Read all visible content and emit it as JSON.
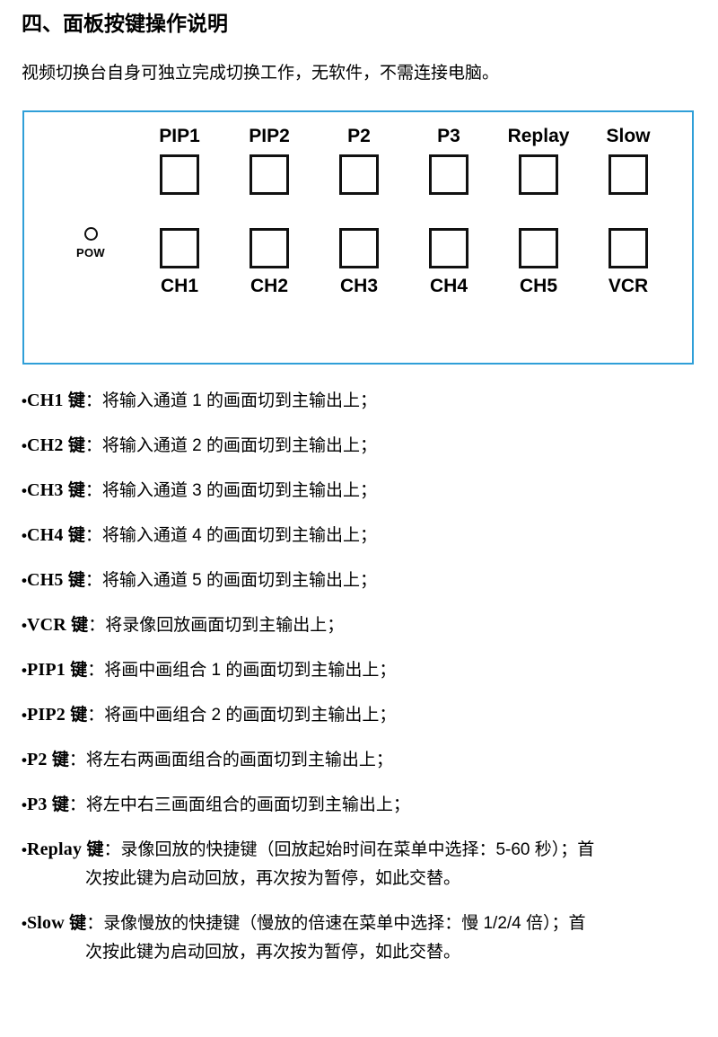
{
  "page": {
    "title": "四、面板按键操作说明",
    "intro": "视频切换台自身可独立完成切换工作，无软件，不需连接电脑。"
  },
  "panel": {
    "border_color": "#2f9fd8",
    "power_indicator": {
      "icon": "power-led-circle-icon",
      "label": "POW"
    },
    "top_row": [
      {
        "label": "PIP1"
      },
      {
        "label": "PIP2"
      },
      {
        "label": "P2"
      },
      {
        "label": "P3"
      },
      {
        "label": "Replay"
      },
      {
        "label": "Slow"
      }
    ],
    "bottom_row": [
      {
        "label": "CH1"
      },
      {
        "label": "CH2"
      },
      {
        "label": "CH3"
      },
      {
        "label": "CH4"
      },
      {
        "label": "CH5"
      },
      {
        "label": "VCR"
      }
    ]
  },
  "descriptions": [
    {
      "bullet": "•",
      "key": "CH1",
      "key_word": "键",
      "text": "：将输入通道 1 的画面切到主输出上；",
      "continued": ""
    },
    {
      "bullet": "•",
      "key": "CH2",
      "key_word": "键",
      "text": "：将输入通道 2 的画面切到主输出上；",
      "continued": ""
    },
    {
      "bullet": "•",
      "key": "CH3",
      "key_word": "键",
      "text": "：将输入通道 3 的画面切到主输出上；",
      "continued": ""
    },
    {
      "bullet": "•",
      "key": "CH4",
      "key_word": "键",
      "text": "：将输入通道 4 的画面切到主输出上；",
      "continued": ""
    },
    {
      "bullet": "•",
      "key": "CH5",
      "key_word": "键",
      "text": "：将输入通道 5 的画面切到主输出上；",
      "continued": ""
    },
    {
      "bullet": "•",
      "key": "VCR",
      "key_word": "键",
      "text": "：将录像回放画面切到主输出上；",
      "continued": ""
    },
    {
      "bullet": "•",
      "key": "PIP1",
      "key_word": "键",
      "text": "：将画中画组合 1 的画面切到主输出上；",
      "continued": ""
    },
    {
      "bullet": "•",
      "key": "PIP2",
      "key_word": "键",
      "text": "：将画中画组合 2 的画面切到主输出上；",
      "continued": ""
    },
    {
      "bullet": "•",
      "key": "P2",
      "key_word": "键",
      "text": "：将左右两画面组合的画面切到主输出上；",
      "continued": ""
    },
    {
      "bullet": "•",
      "key": "P3",
      "key_word": "键",
      "text": "：将左中右三画面组合的画面切到主输出上；",
      "continued": ""
    },
    {
      "bullet": "•",
      "key": "Replay",
      "key_word": "键",
      "text": "：录像回放的快捷键（回放起始时间在菜单中选择：5-60 秒）；首",
      "continued": "次按此键为启动回放，再次按为暂停，如此交替。"
    },
    {
      "bullet": "•",
      "key": "Slow",
      "key_word": "键",
      "text": "：录像慢放的快捷键（慢放的倍速在菜单中选择：慢 1/2/4 倍）；首",
      "continued": "次按此键为启动回放，再次按为暂停，如此交替。"
    }
  ]
}
